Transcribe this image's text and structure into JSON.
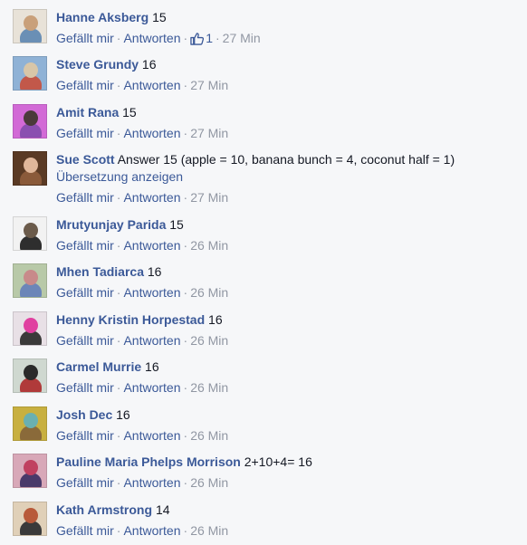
{
  "ui": {
    "like_label": "Gefällt mir",
    "reply_label": "Antworten",
    "separator": "·"
  },
  "comments": [
    {
      "author": "Hanne Aksberg",
      "text": "15",
      "time": "27 Min",
      "likes": "1",
      "avatar_colors": [
        "#e8e2d8",
        "#c9a07a",
        "#6a8fb5"
      ]
    },
    {
      "author": "Steve Grundy",
      "text": "16",
      "time": "27 Min",
      "avatar_colors": [
        "#8fb2d6",
        "#d8c6a8",
        "#c2584a"
      ]
    },
    {
      "author": "Amit Rana",
      "text": "15",
      "time": "27 Min",
      "avatar_colors": [
        "#d26ad6",
        "#4a3a3a",
        "#8a4fb0"
      ]
    },
    {
      "author": "Sue Scott",
      "text": "Answer 15 (apple = 10, banana bunch = 4, coconut half = 1)",
      "translate": "Übersetzung anzeigen",
      "time": "27 Min",
      "avatar_colors": [
        "#5a3a24",
        "#e0b79a",
        "#8a5a3a"
      ]
    },
    {
      "author": "Mrutyunjay Parida",
      "text": "15",
      "time": "26 Min",
      "avatar_colors": [
        "#f2f2f2",
        "#6b5b4b",
        "#2e2e2e"
      ]
    },
    {
      "author": "Mhen Tadiarca",
      "text": "16",
      "time": "26 Min",
      "avatar_colors": [
        "#b8c9a8",
        "#c88a8a",
        "#6c86b8"
      ]
    },
    {
      "author": "Henny Kristin Horpestad",
      "text": "16",
      "time": "26 Min",
      "avatar_colors": [
        "#e8e0e6",
        "#e040a0",
        "#3a3a3a"
      ]
    },
    {
      "author": "Carmel Murrie",
      "text": "16",
      "time": "26 Min",
      "avatar_colors": [
        "#cfd8d0",
        "#2a2a2a",
        "#b03a3a"
      ]
    },
    {
      "author": "Josh Dec",
      "text": "16",
      "time": "26 Min",
      "avatar_colors": [
        "#c8b040",
        "#6ab0b0",
        "#8a6a3a"
      ]
    },
    {
      "author": "Pauline Maria Phelps Morrison",
      "text": "2+10+4= 16",
      "time": "26 Min",
      "avatar_colors": [
        "#d8a8b8",
        "#c04060",
        "#4a3a6a"
      ]
    },
    {
      "author": "Kath Armstrong",
      "text": "14",
      "time": "26 Min",
      "avatar_colors": [
        "#e0d0b8",
        "#b85a3a",
        "#3a3a3a"
      ]
    }
  ]
}
